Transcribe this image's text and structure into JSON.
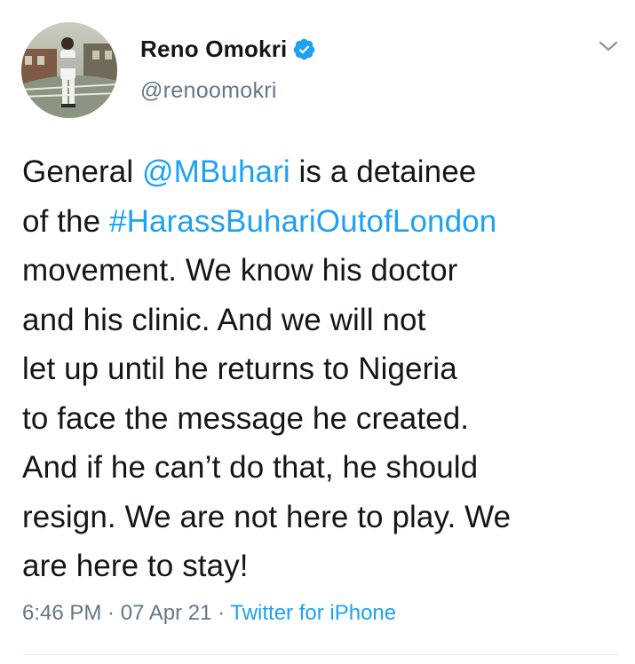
{
  "author": {
    "display_name": "Reno Omokri",
    "handle": "@renoomokri",
    "verified": true,
    "avatar_icon": "profile-photo"
  },
  "tweet": {
    "lines": [
      {
        "segments": [
          {
            "text": "General ",
            "link": false
          },
          {
            "text": "@MBuhari",
            "link": true
          },
          {
            "text": " is a detainee",
            "link": false
          }
        ]
      },
      {
        "segments": [
          {
            "text": "of the ",
            "link": false
          },
          {
            "text": "#HarassBuhariOutofLondon",
            "link": true
          }
        ]
      },
      {
        "segments": [
          {
            "text": "movement. We know his doctor",
            "link": false
          }
        ]
      },
      {
        "segments": [
          {
            "text": "and his clinic. And we will not",
            "link": false
          }
        ]
      },
      {
        "segments": [
          {
            "text": "let up until he returns to Nigeria",
            "link": false
          }
        ]
      },
      {
        "segments": [
          {
            "text": "to face the message he created.",
            "link": false
          }
        ]
      },
      {
        "segments": [
          {
            "text": "And if he can’t do that, he should",
            "link": false
          }
        ]
      },
      {
        "segments": [
          {
            "text": "resign. We are not here to play. We",
            "link": false
          }
        ]
      },
      {
        "segments": [
          {
            "text": "are here to stay!",
            "link": false
          }
        ]
      }
    ]
  },
  "meta": {
    "time": "6:46 PM",
    "sep1": " · ",
    "date": "07 Apr 21",
    "sep2": " · ",
    "source": "Twitter for iPhone"
  },
  "colors": {
    "text": "#14171a",
    "secondary": "#657786",
    "link": "#1da1f2",
    "verified": "#1da1f2",
    "divider": "#e1e8ed"
  },
  "icons": {
    "verified": "verified-badge-icon",
    "menu": "chevron-down-icon"
  }
}
